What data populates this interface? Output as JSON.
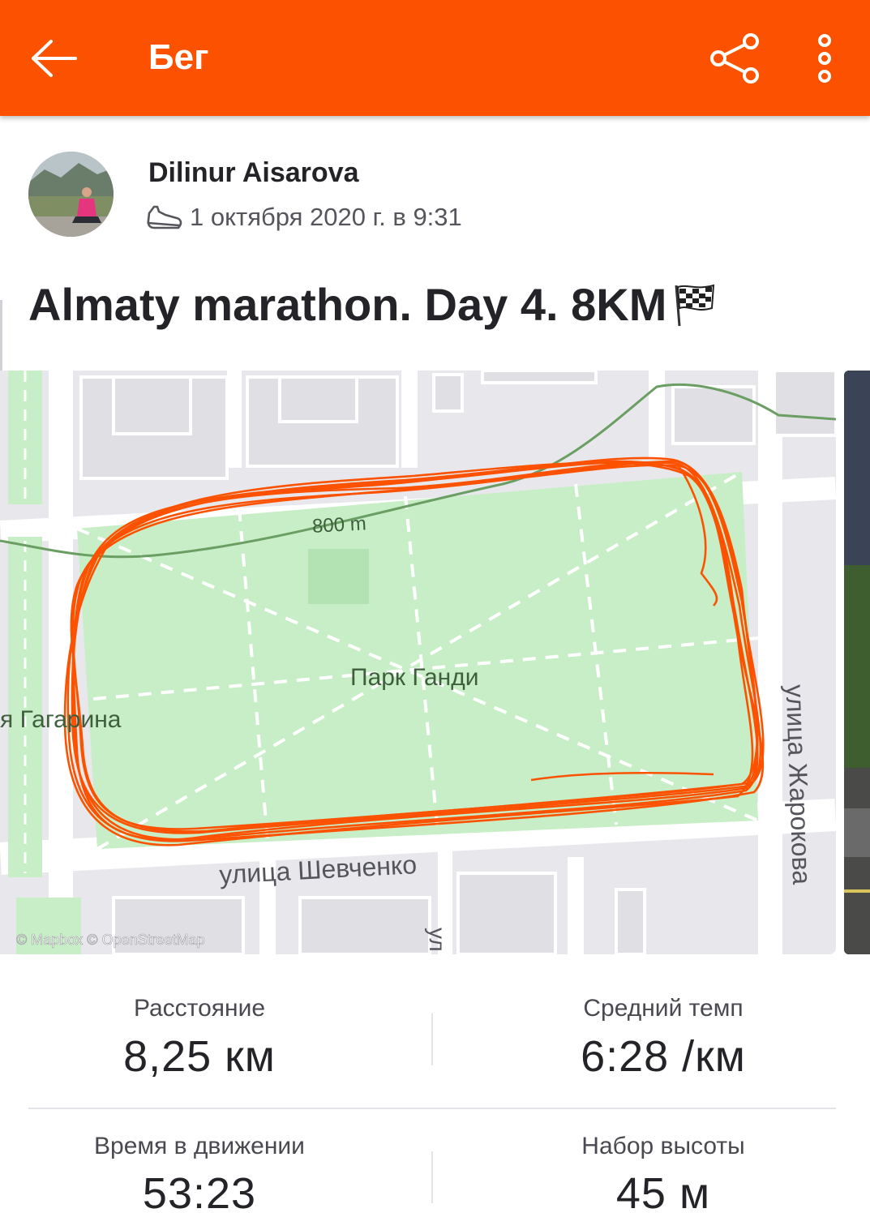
{
  "appbar": {
    "title": "Бег",
    "back_icon": "arrow-left-icon",
    "share_icon": "share-icon",
    "more_icon": "more-vertical-icon",
    "color": "#fc5200"
  },
  "athlete": {
    "name": "Dilinur Aisarova",
    "date": "1 октября 2020 г. в 9:31",
    "sport_icon": "running-shoe-icon"
  },
  "activity": {
    "title": "Almaty marathon. Day 4. 8KM",
    "flag_icon": "checkered-flag-icon"
  },
  "map": {
    "park_label": "Парк Ганди",
    "scale_label": "800 m",
    "street_left": "я Гагарина",
    "street_bottom": "улица Шевченко",
    "street_right": "улица Жарокова",
    "street_bottom_small": "ул",
    "attribution": "© Mapbox © OpenStreetMap",
    "route_color": "#fc5200"
  },
  "stats": [
    {
      "label": "Расстояние",
      "value": "8,25 км"
    },
    {
      "label": "Средний темп",
      "value": "6:28 /км"
    },
    {
      "label": "Время в движении",
      "value": "53:23"
    },
    {
      "label": "Набор высоты",
      "value": "45 м"
    }
  ]
}
